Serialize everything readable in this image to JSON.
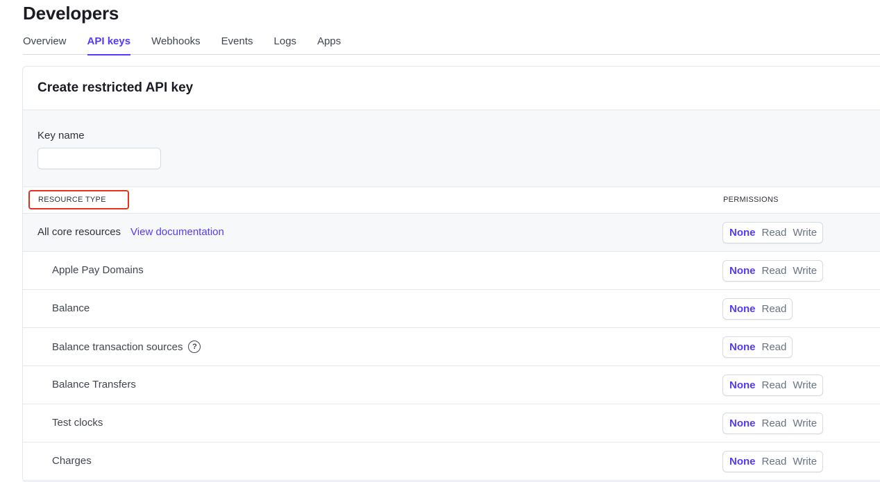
{
  "page": {
    "title": "Developers"
  },
  "tabs": [
    {
      "label": "Overview"
    },
    {
      "label": "API keys"
    },
    {
      "label": "Webhooks"
    },
    {
      "label": "Events"
    },
    {
      "label": "Logs"
    },
    {
      "label": "Apps"
    }
  ],
  "card": {
    "title": "Create restricted API key",
    "key_name_label": "Key name",
    "key_name_value": ""
  },
  "table": {
    "header_resource": "RESOURCE TYPE",
    "header_permissions": "PERMISSIONS",
    "core_label": "All core resources",
    "core_link": "View documentation",
    "rows": [
      {
        "label": "All core resources",
        "options": [
          "None",
          "Read",
          "Write"
        ],
        "selected": "None"
      },
      {
        "label": "Apple Pay Domains",
        "options": [
          "None",
          "Read",
          "Write"
        ],
        "selected": "None"
      },
      {
        "label": "Balance",
        "options": [
          "None",
          "Read"
        ],
        "selected": "None"
      },
      {
        "label": "Balance transaction sources",
        "options": [
          "None",
          "Read"
        ],
        "selected": "None"
      },
      {
        "label": "Balance Transfers",
        "options": [
          "None",
          "Read",
          "Write"
        ],
        "selected": "None"
      },
      {
        "label": "Test clocks",
        "options": [
          "None",
          "Read",
          "Write"
        ],
        "selected": "None"
      },
      {
        "label": "Charges",
        "options": [
          "None",
          "Read",
          "Write"
        ],
        "selected": "None"
      }
    ]
  },
  "colors": {
    "accent": "#533afd",
    "highlight_border": "#e0321d"
  },
  "icons": {
    "help": "question-circle-icon"
  }
}
